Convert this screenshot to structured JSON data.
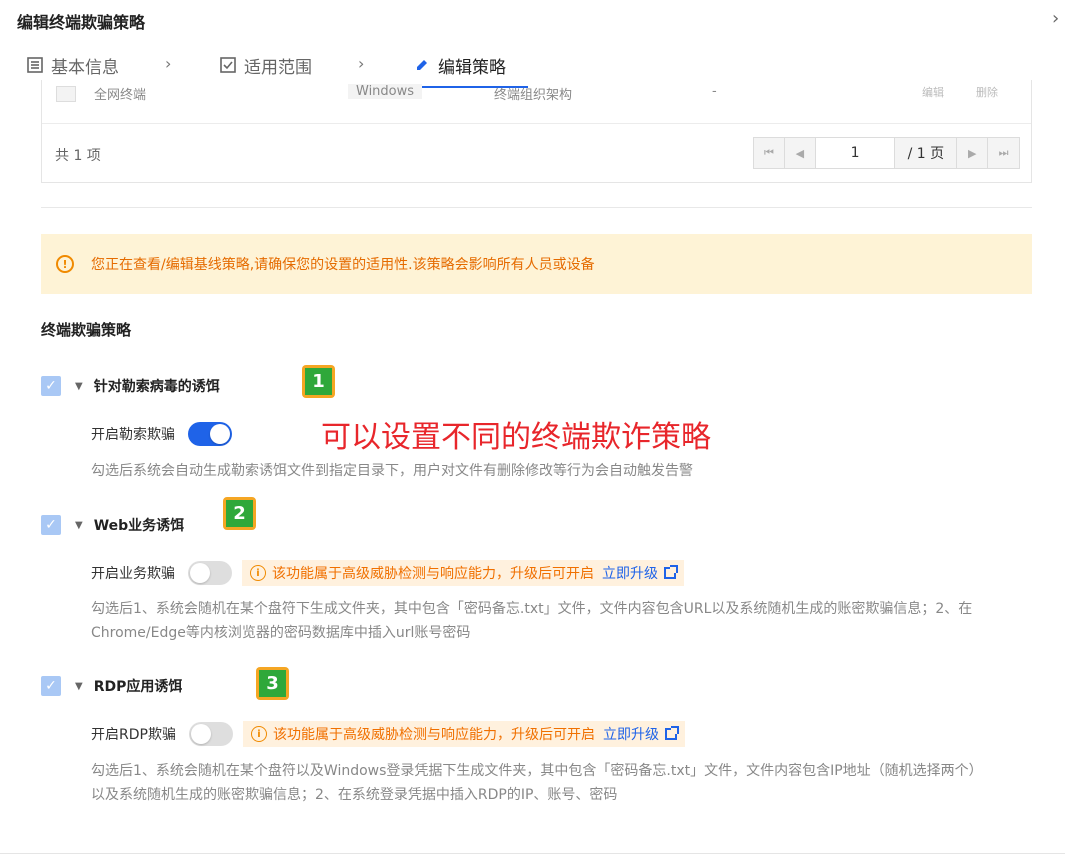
{
  "header": {
    "title": "编辑终端欺骗策略",
    "close": "›"
  },
  "steps": [
    {
      "label": "基本信息",
      "icon": "list-icon"
    },
    {
      "label": "适用范围",
      "icon": "checklist-icon"
    },
    {
      "label": "编辑策略",
      "icon": "pencil-icon",
      "active": true
    }
  ],
  "step_separator": "›",
  "table": {
    "cut_row": [
      "全网终端",
      "Windows",
      "终端组织架构",
      "-",
      "编辑",
      "删除"
    ],
    "total": "共 1 项",
    "pager": {
      "first": "⏮",
      "prev": "◀",
      "page": "1",
      "total_pages": "/ 1 页",
      "next": "▶",
      "last": "⏭"
    }
  },
  "alert": {
    "icon": "!",
    "text": "您正在查看/编辑基线策略,请确保您的设置的适用性.该策略会影响所有人员或设备"
  },
  "section_title": "终端欺骗策略",
  "items": [
    {
      "label": "针对勒索病毒的诱饵",
      "checked": true,
      "option_label": "开启勒索欺骗",
      "enabled": true,
      "description": [
        "勾选后系统会自动生成勒索诱饵文件到指定目录下，用户对文件有删除修改等行为会自动触发告警"
      ]
    },
    {
      "label": "Web业务诱饵",
      "checked": true,
      "option_label": "开启业务欺骗",
      "enabled": false,
      "upgrade_text": "该功能属于高级威胁检测与响应能力，升级后可开启",
      "upgrade_link": "立即升级",
      "description": [
        "勾选后1、系统会随机在某个盘符下生成文件夹，其中包含「密码备忘.txt」文件，文件内容包含URL以及系统随机生成的账密欺骗信息；2、在",
        "Chrome/Edge等内核浏览器的密码数据库中插入url账号密码"
      ]
    },
    {
      "label": "RDP应用诱饵",
      "checked": true,
      "option_label": "开启RDP欺骗",
      "enabled": false,
      "upgrade_text": "该功能属于高级威胁检测与响应能力，升级后可开启",
      "upgrade_link": "立即升级",
      "description": [
        "勾选后1、系统会随机在某个盘符以及Windows登录凭据下生成文件夹，其中包含「密码备忘.txt」文件，文件内容包含IP地址（随机选择两个）",
        "以及系统随机生成的账密欺骗信息；2、在系统登录凭据中插入RDP的IP、账号、密码"
      ]
    }
  ],
  "annotations": {
    "badges": [
      "1",
      "2",
      "3"
    ],
    "overlay_text": "可以设置不同的终端欺诈策略"
  },
  "colors": {
    "primary": "#1f63e8",
    "warning": "#f08a00",
    "alert_bg": "#fef3d6",
    "badge_green": "#2fa83a",
    "overlay_red": "#e8262b"
  }
}
